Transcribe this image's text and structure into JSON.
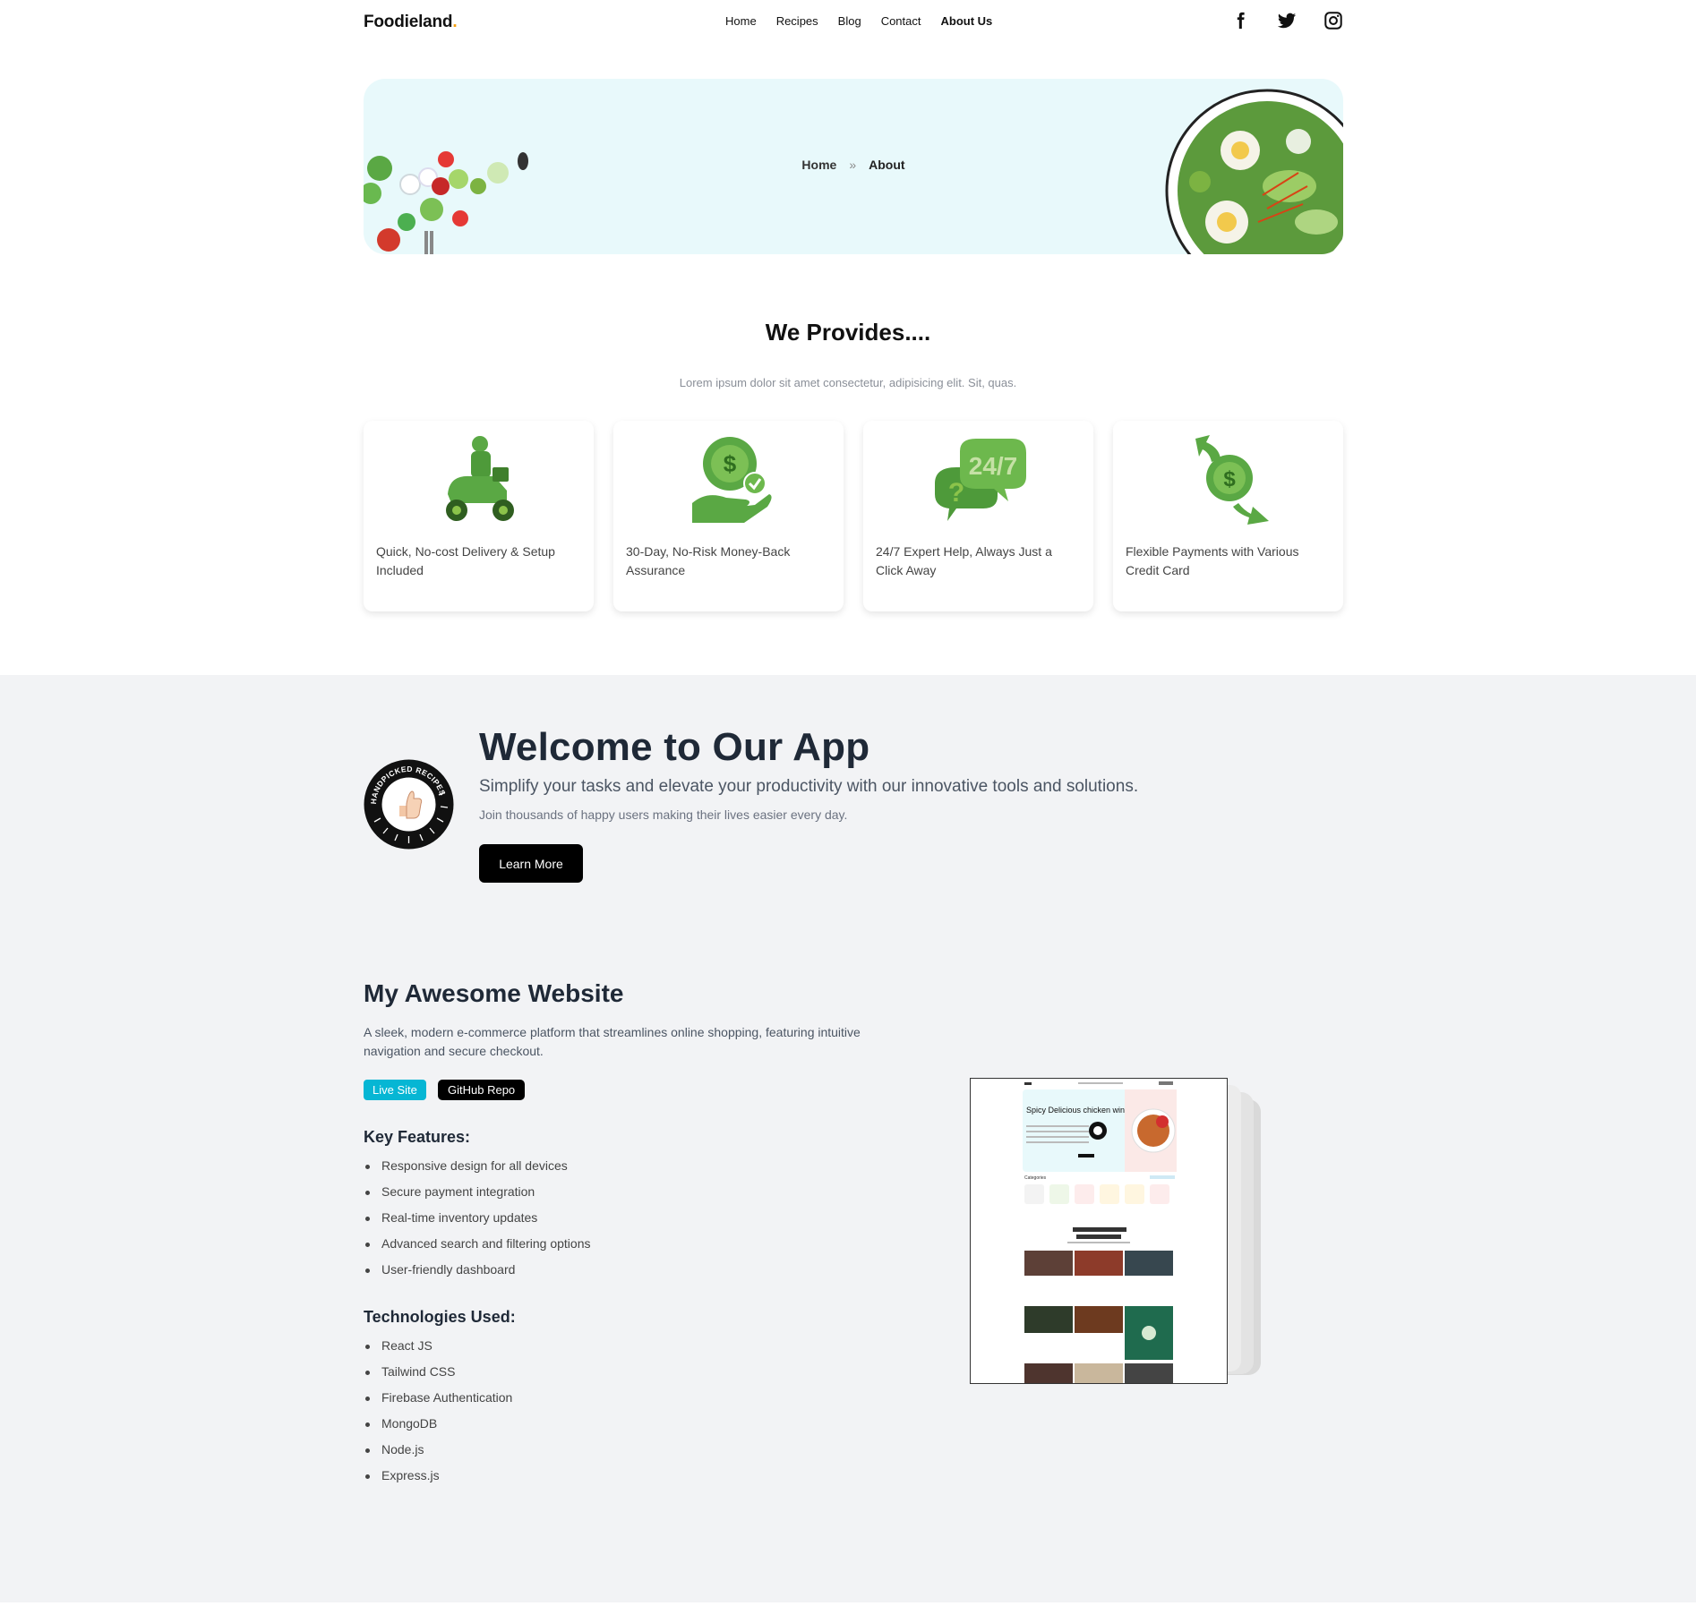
{
  "header": {
    "logo": "Foodieland",
    "logo_dot": ".",
    "nav": [
      "Home",
      "Recipes",
      "Blog",
      "Contact",
      "About Us"
    ],
    "active_nav": "About Us",
    "socials": [
      "facebook-icon",
      "twitter-icon",
      "instagram-icon"
    ]
  },
  "hero": {
    "breadcrumb_home": "Home",
    "breadcrumb_separator": "»",
    "breadcrumb_current": "About",
    "background": "#e8f9fb"
  },
  "provides": {
    "title": "We Provides....",
    "subtitle": "Lorem ipsum dolor sit amet consectetur, adipisicing elit. Sit, quas.",
    "cards": [
      {
        "icon": "scooter-delivery-icon",
        "text": "Quick, No-cost Delivery & Setup Included"
      },
      {
        "icon": "money-back-icon",
        "text": "30-Day, No-Risk Money-Back Assurance"
      },
      {
        "icon": "support-24-7-icon",
        "text": "24/7 Expert Help, Always Just a Click Away"
      },
      {
        "icon": "flexible-payment-icon",
        "text": "Flexible Payments with Various Credit Card"
      }
    ]
  },
  "welcome": {
    "badge_text": "HANDPICKED RECIPES",
    "title": "Welcome to Our App",
    "subtitle": "Simplify your tasks and elevate your productivity with our innovative tools and solutions.",
    "small": "Join thousands of happy users making their lives easier every day.",
    "button": "Learn More"
  },
  "project": {
    "title": "My Awesome Website",
    "description": "A sleek, modern e-commerce platform that streamlines online shopping, featuring intuitive navigation and secure checkout.",
    "live_label": "Live Site",
    "github_label": "GitHub Repo",
    "features_heading": "Key Features:",
    "features": [
      "Responsive design for all devices",
      "Secure payment integration",
      "Real-time inventory updates",
      "Advanced search and filtering options",
      "User-friendly dashboard"
    ],
    "tech_heading": "Technologies Used:",
    "tech": [
      "React JS",
      "Tailwind CSS",
      "Firebase Authentication",
      "MongoDB",
      "Node.js",
      "Express.js"
    ],
    "screenshot": {
      "hero_title": "Spicy Delicious chicken wings",
      "categories_label": "Categories"
    }
  },
  "colors": {
    "accent_cyan": "#06b6d4",
    "icon_green": "#5aa844",
    "section_gray": "#f2f3f5"
  }
}
